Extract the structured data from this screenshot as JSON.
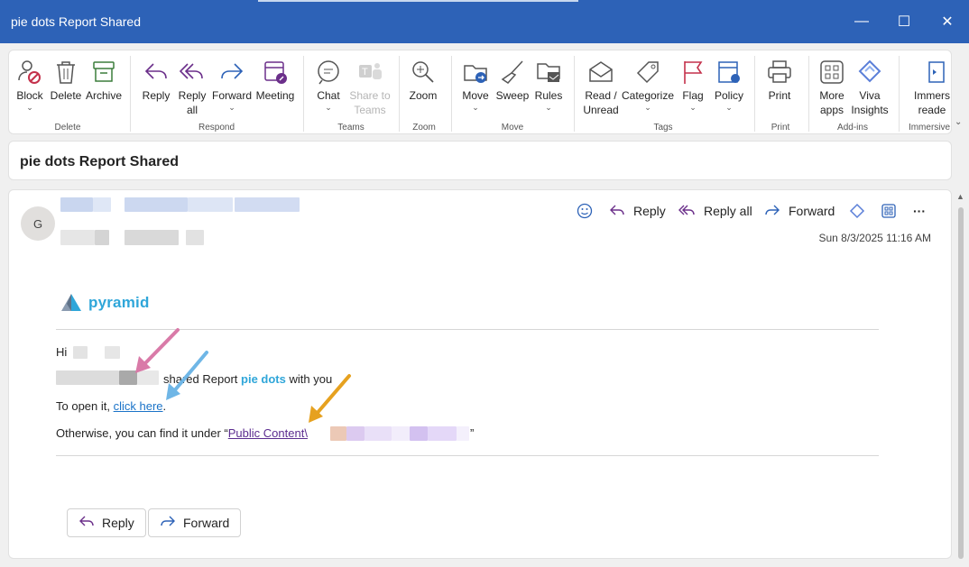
{
  "window": {
    "title": "pie dots Report Shared",
    "minimize": "—",
    "maximize": "☐",
    "close": "✕"
  },
  "ribbon": {
    "groups": {
      "delete": "Delete",
      "respond": "Respond",
      "teams": "Teams",
      "zoom": "Zoom",
      "move": "Move",
      "tags": "Tags",
      "print": "Print",
      "addins": "Add-ins",
      "immersive": "Immersive"
    },
    "buttons": {
      "block": "Block",
      "delete": "Delete",
      "archive": "Archive",
      "reply": "Reply",
      "reply_all_1": "Reply",
      "reply_all_2": "all",
      "forward": "Forward",
      "meeting": "Meeting",
      "chat": "Chat",
      "share_teams_1": "Share to",
      "share_teams_2": "Teams",
      "zoom": "Zoom",
      "move": "Move",
      "sweep": "Sweep",
      "rules": "Rules",
      "read_unread_1": "Read /",
      "read_unread_2": "Unread",
      "categorize": "Categorize",
      "flag": "Flag",
      "policy": "Policy",
      "print": "Print",
      "more_apps_1": "More",
      "more_apps_2": "apps",
      "viva_1": "Viva",
      "viva_2": "Insights",
      "immersive_1": "Immers",
      "immersive_2": "reade"
    }
  },
  "subject": "pie dots Report Shared",
  "message": {
    "avatar_initial": "G",
    "actions": {
      "reply": "Reply",
      "reply_all": "Reply all",
      "forward": "Forward",
      "more": "···"
    },
    "date": "Sun 8/3/2025 11:16 AM",
    "logo_text": "pyramid",
    "greeting": "Hi",
    "shared_prefix": "shared Report",
    "report_name": "pie dots",
    "shared_suffix": "with you",
    "open_prefix": "To open it,",
    "open_link": "click here",
    "open_suffix": ".",
    "find_prefix": "Otherwise, you can find it under “",
    "find_link": "Public Content\\",
    "find_suffix": "”",
    "footer_reply": "Reply",
    "footer_forward": "Forward"
  },
  "colors": {
    "titlebar": "#2d62b7",
    "accent_purple": "#6b2f8a",
    "accent_blue": "#1a73c8",
    "arrow_pink": "#d97aa8",
    "arrow_blue": "#6fb6e6",
    "arrow_orange": "#e6a11f"
  }
}
